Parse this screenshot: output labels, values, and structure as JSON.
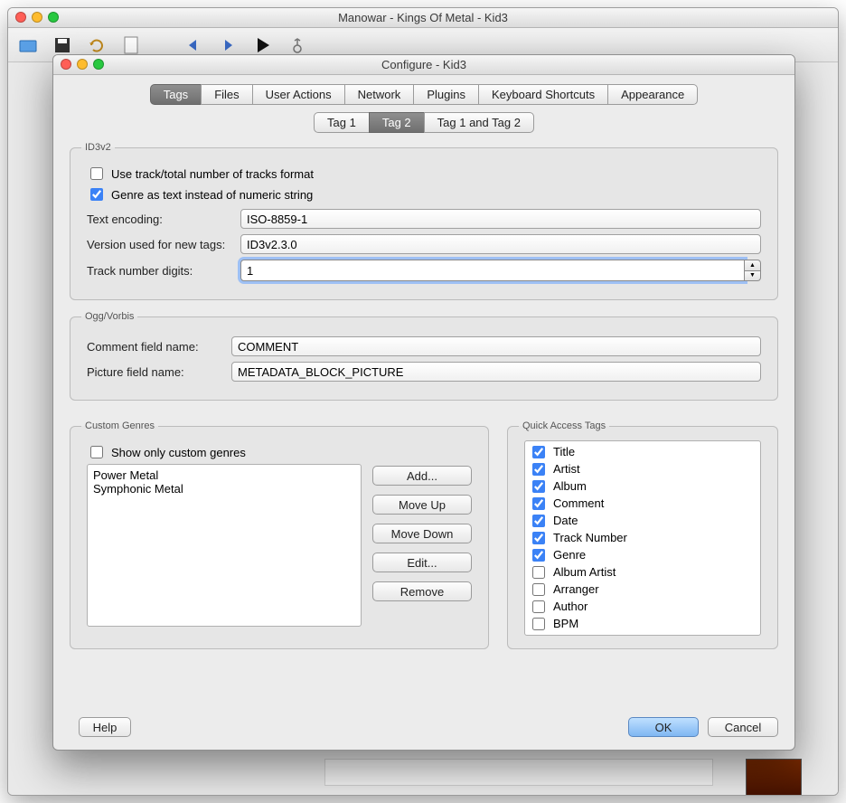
{
  "main_window": {
    "title": "Manowar - Kings Of Metal - Kid3"
  },
  "dialog": {
    "title": "Configure - Kid3",
    "tabs": [
      "Tags",
      "Files",
      "User Actions",
      "Network",
      "Plugins",
      "Keyboard Shortcuts",
      "Appearance"
    ],
    "tabs_active": 0,
    "subtabs": [
      "Tag 1",
      "Tag 2",
      "Tag 1 and Tag 2"
    ],
    "subtabs_active": 1,
    "id3v2": {
      "legend": "ID3v2",
      "track_total": {
        "label": "Use track/total number of tracks format",
        "checked": false
      },
      "genre_text": {
        "label": "Genre as text instead of numeric string",
        "checked": true
      },
      "text_encoding_label": "Text encoding:",
      "text_encoding_value": "ISO-8859-1",
      "version_label": "Version used for new tags:",
      "version_value": "ID3v2.3.0",
      "track_digits_label": "Track number digits:",
      "track_digits_value": "1"
    },
    "ogg": {
      "legend": "Ogg/Vorbis",
      "comment_label": "Comment field name:",
      "comment_value": "COMMENT",
      "picture_label": "Picture field name:",
      "picture_value": "METADATA_BLOCK_PICTURE"
    },
    "custom_genres": {
      "legend": "Custom Genres",
      "show_only": {
        "label": "Show only custom genres",
        "checked": false
      },
      "items": [
        "Power Metal",
        "Symphonic Metal"
      ],
      "btn_add": "Add...",
      "btn_up": "Move Up",
      "btn_down": "Move Down",
      "btn_edit": "Edit...",
      "btn_remove": "Remove"
    },
    "quick_access": {
      "legend": "Quick Access Tags",
      "items": [
        {
          "label": "Title",
          "checked": true
        },
        {
          "label": "Artist",
          "checked": true
        },
        {
          "label": "Album",
          "checked": true
        },
        {
          "label": "Comment",
          "checked": true
        },
        {
          "label": "Date",
          "checked": true
        },
        {
          "label": "Track Number",
          "checked": true
        },
        {
          "label": "Genre",
          "checked": true
        },
        {
          "label": "Album Artist",
          "checked": false
        },
        {
          "label": "Arranger",
          "checked": false
        },
        {
          "label": "Author",
          "checked": false
        },
        {
          "label": "BPM",
          "checked": false
        }
      ]
    },
    "footer": {
      "help": "Help",
      "ok": "OK",
      "cancel": "Cancel"
    }
  }
}
